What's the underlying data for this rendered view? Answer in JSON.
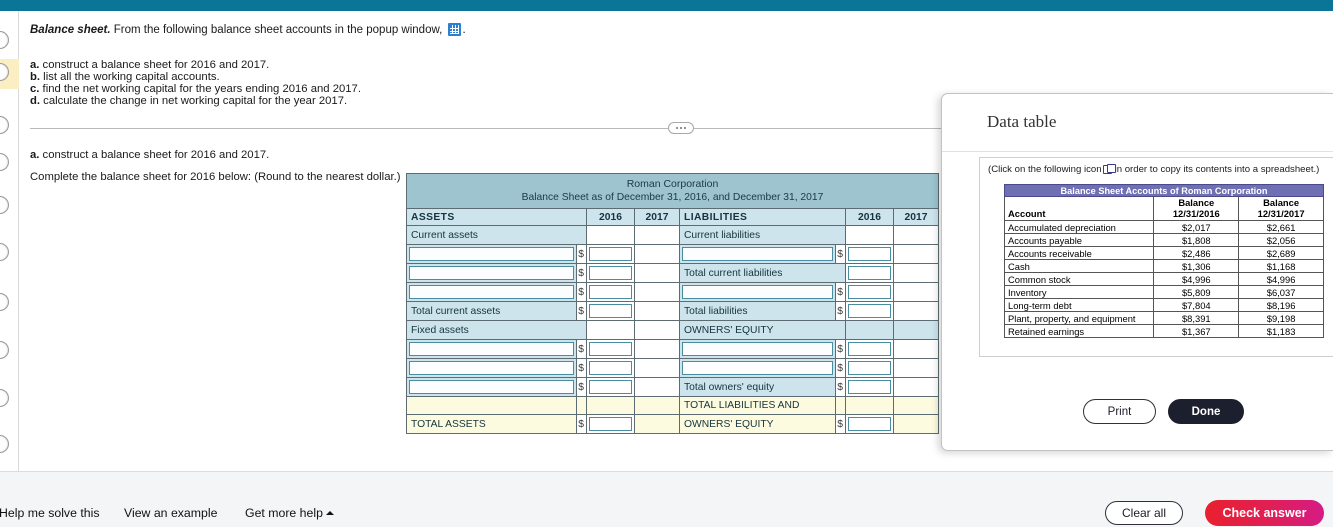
{
  "header": {
    "bar_color": "#0a7596"
  },
  "question": {
    "lead_title": "Balance sheet.",
    "lead_text": "From the following balance sheet accounts in the popup window,",
    "lead_tail": ".",
    "parts": [
      {
        "letter": "a.",
        "text": " construct a balance sheet for 2016 and 2017."
      },
      {
        "letter": "b.",
        "text": " list all the working capital accounts."
      },
      {
        "letter": "c.",
        "text": " find the net working capital for the years ending 2016 and 2017."
      },
      {
        "letter": "d.",
        "text": " calculate the change in net working capital for the year 2017."
      }
    ],
    "subquestion_letter": "a.",
    "subquestion_text": " construct a balance sheet for 2016 and 2017.",
    "instruction": "Complete the balance sheet for 2016 below:  (Round to the nearest dollar.)"
  },
  "balance_sheet": {
    "company": "Roman Corporation",
    "subtitle": "Balance Sheet as of December 31, 2016, and December 31, 2017",
    "headers": {
      "assets": "ASSETS",
      "liabilities": "LIABILITIES",
      "year1": "2016",
      "year2": "2017"
    },
    "assets_rows": [
      {
        "label": "Current assets",
        "type": "section"
      },
      {
        "label": "",
        "type": "input"
      },
      {
        "label": "",
        "type": "input"
      },
      {
        "label": "",
        "type": "input"
      },
      {
        "label": "Total current assets",
        "type": "total"
      },
      {
        "label": "Fixed assets",
        "type": "section"
      },
      {
        "label": "",
        "type": "input"
      },
      {
        "label": "",
        "type": "input"
      },
      {
        "label": "",
        "type": "input"
      },
      {
        "label": "TOTAL ASSETS",
        "type": "grand"
      }
    ],
    "liabilities_rows": [
      {
        "label": "Current liabilities",
        "type": "section"
      },
      {
        "label": "",
        "type": "input"
      },
      {
        "label": "Total current liabilities",
        "type": "total"
      },
      {
        "label": "",
        "type": "input"
      },
      {
        "label": "Total liabilities",
        "type": "total"
      },
      {
        "label": "OWNERS' EQUITY",
        "type": "section"
      },
      {
        "label": "",
        "type": "input"
      },
      {
        "label": "",
        "type": "input"
      },
      {
        "label": "Total owners' equity",
        "type": "total"
      },
      {
        "label": "TOTAL LIABILITIES AND",
        "label2": "OWNERS' EQUITY",
        "type": "grand"
      }
    ],
    "currency_symbol": "$",
    "colors": {
      "title_bg": "#9dc4cf",
      "header_bg": "#cde4ec",
      "total_bg": "#fcfbe0"
    }
  },
  "popup": {
    "title": "Data table",
    "note_prefix": "(Click on the following icon",
    "note_suffix": "in order to copy its contents into a spreadsheet.)",
    "table_title": "Balance Sheet Accounts of Roman Corporation",
    "columns": [
      "Account",
      "Balance\n12/31/2016",
      "Balance\n12/31/2017"
    ],
    "col_account": "Account",
    "col_bal_label": "Balance",
    "col_bal_2016_date": "12/31/2016",
    "col_bal_2017_date": "12/31/2017",
    "rows": [
      {
        "account": "Accumulated depreciation",
        "bal2016": "$2,017",
        "bal2017": "$2,661"
      },
      {
        "account": "Accounts payable",
        "bal2016": "$1,808",
        "bal2017": "$2,056"
      },
      {
        "account": "Accounts receivable",
        "bal2016": "$2,486",
        "bal2017": "$2,689"
      },
      {
        "account": "Cash",
        "bal2016": "$1,306",
        "bal2017": "$1,168"
      },
      {
        "account": "Common stock",
        "bal2016": "$4,996",
        "bal2017": "$4,996"
      },
      {
        "account": "Inventory",
        "bal2016": "$5,809",
        "bal2017": "$6,037"
      },
      {
        "account": "Long-term debt",
        "bal2016": "$7,804",
        "bal2017": "$8,196"
      },
      {
        "account": "Plant, property, and equipment",
        "bal2016": "$8,391",
        "bal2017": "$9,198"
      },
      {
        "account": "Retained earnings",
        "bal2016": "$1,367",
        "bal2017": "$1,183"
      }
    ],
    "print_label": "Print",
    "done_label": "Done",
    "title_bg": "#6f6fb4"
  },
  "footer": {
    "help_solve": "Help me solve this",
    "view_example": "View an example",
    "get_more_help": "Get more help",
    "clear_all": "Clear all",
    "check_answer": "Check answer",
    "check_color": "#e01f56"
  }
}
